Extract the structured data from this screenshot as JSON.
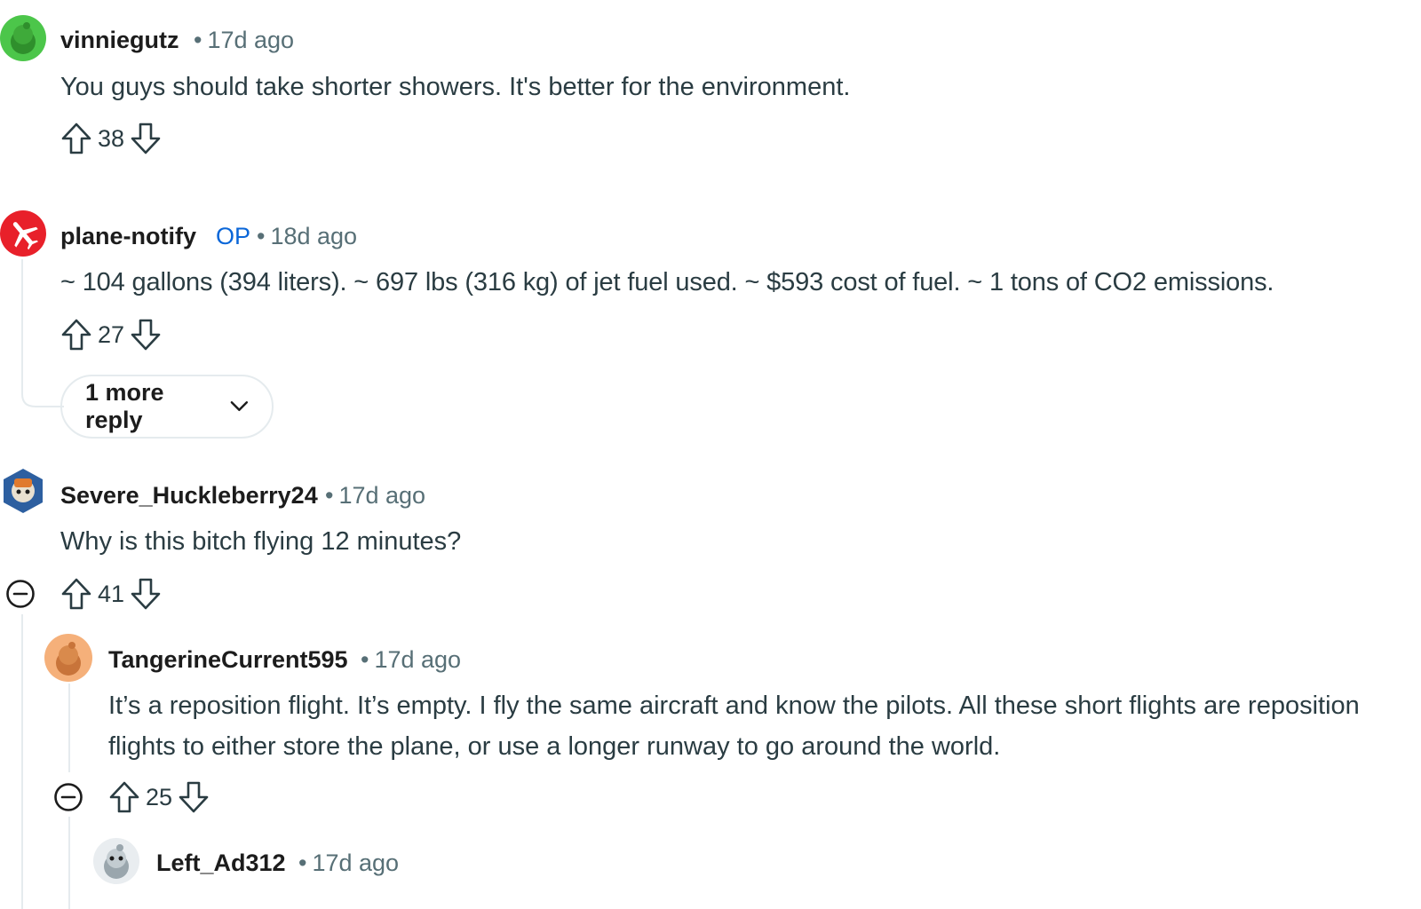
{
  "comments": [
    {
      "username": "vinniegutz",
      "time": "17d ago",
      "text": "You guys should take shorter showers. It's better for the environment.",
      "score": "38",
      "avatar": "snoo-green-avatar"
    },
    {
      "username": "plane-notify",
      "badge": "OP",
      "time": "18d ago",
      "text": "~ 104 gallons (394 liters). ~ 697 lbs (316 kg) of jet fuel used. ~ $593 cost of fuel. ~ 1 tons of CO2 emissions.",
      "score": "27",
      "avatar": "airplane-red-avatar",
      "more_replies_label": "1 more reply"
    },
    {
      "username": "Severe_Huckleberry24",
      "time": "17d ago",
      "text": "Why is this bitch flying 12 minutes?",
      "score": "41",
      "avatar": "snoo-hexagon-avatar"
    },
    {
      "username": "TangerineCurrent595",
      "time": "17d ago",
      "text": "It’s a reposition flight. It’s empty. I fly the same aircraft and know the pilots. All these short flights are reposition flights to either store the plane, or use a longer runway to go around the world.",
      "score": "25",
      "avatar": "snoo-orange-avatar"
    },
    {
      "username": "Left_Ad312",
      "time": "17d ago",
      "avatar": "snoo-grey-avatar"
    }
  ],
  "colors": {
    "meta": "#576f76",
    "op_badge": "#0a66d8",
    "thread_line": "#e5ebee"
  },
  "icons": [
    "upvote-icon",
    "downvote-icon",
    "collapse-icon",
    "chevron-down-icon"
  ]
}
